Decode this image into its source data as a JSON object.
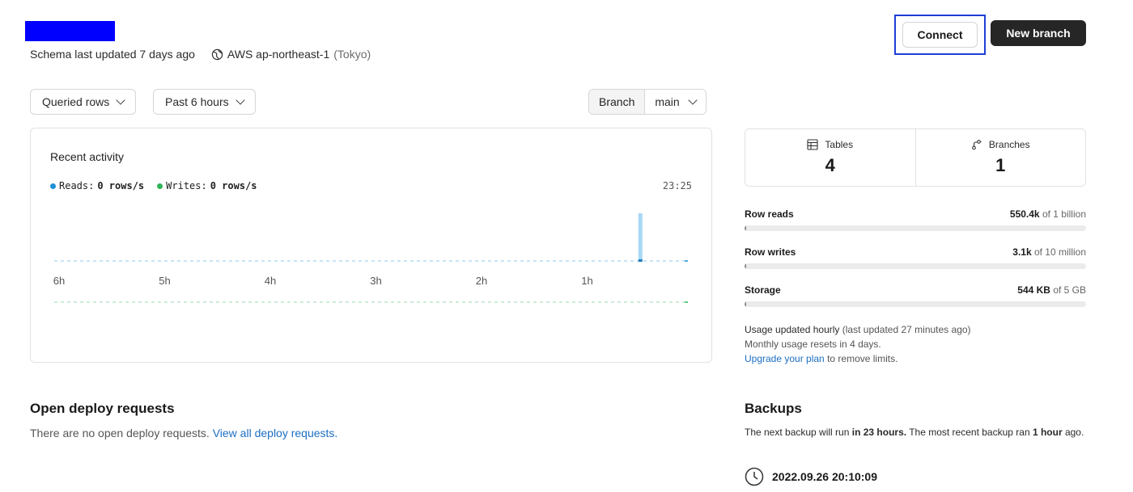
{
  "header": {
    "schema_updated": "Schema last updated 7 days ago",
    "region": "AWS ap-northeast-1",
    "region_city": "(Tokyo)"
  },
  "actions": {
    "connect_label": "Connect",
    "new_branch_label": "New branch"
  },
  "filters": {
    "metric": "Queried rows",
    "range": "Past 6 hours",
    "branch_label": "Branch",
    "branch_value": "main"
  },
  "activity": {
    "title": "Recent activity",
    "reads_label": "Reads:",
    "reads_value": "0 rows/s",
    "writes_label": "Writes:",
    "writes_value": "0 rows/s",
    "time": "23:25",
    "reads_color": "#1e90d6",
    "writes_color": "#2fb457"
  },
  "chart_data": {
    "type": "bar",
    "categories": [
      "6h",
      "5h",
      "4h",
      "3h",
      "2h",
      "1h"
    ],
    "series": [
      {
        "values": [
          0,
          0,
          0,
          0,
          0,
          0
        ]
      }
    ],
    "spike": {
      "hours_ago": 0.45,
      "value": 1
    },
    "ylim": [
      0,
      1
    ]
  },
  "stats": {
    "tables_label": "Tables",
    "tables_value": "4",
    "branches_label": "Branches",
    "branches_value": "1"
  },
  "usage": {
    "row_reads": {
      "name": "Row reads",
      "used": "550.4k",
      "limit": "of 1 billion",
      "fraction": 0.00055
    },
    "row_writes": {
      "name": "Row writes",
      "used": "3.1k",
      "limit": "of 10 million",
      "fraction": 0.0003
    },
    "storage": {
      "name": "Storage",
      "used": "544 KB",
      "limit": "of 5 GB",
      "fraction": 0.0001
    },
    "note_strong": "Usage updated hourly",
    "note_muted": "(last updated 27 minutes ago)",
    "reset_note": "Monthly usage resets in 4 days.",
    "upgrade_link": "Upgrade your plan",
    "upgrade_rest": "to remove limits."
  },
  "deploy": {
    "title": "Open deploy requests",
    "text": "There are no open deploy requests.",
    "link": "View all deploy requests",
    "period": "."
  },
  "backups": {
    "title": "Backups",
    "t1": "The next backup will run ",
    "b1": "in 23 hours.",
    "t2": " The most recent backup ran ",
    "b2": "1 hour",
    "t3": " ago.",
    "last_time": "2022.09.26 20:10:09"
  }
}
